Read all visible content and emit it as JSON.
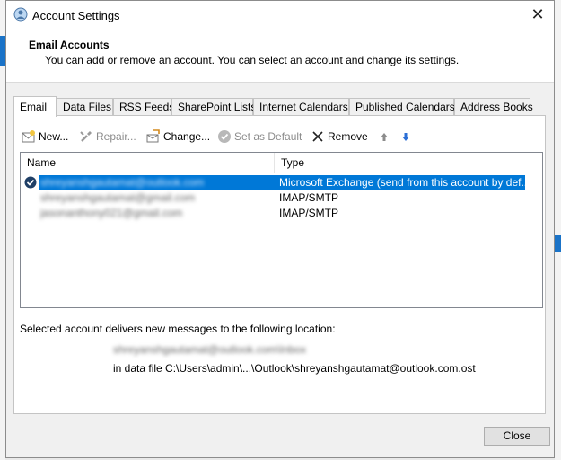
{
  "window": {
    "title": "Account Settings",
    "close_glyph": "✕"
  },
  "header": {
    "title": "Email Accounts",
    "subtitle": "You can add or remove an account. You can select an account and change its settings."
  },
  "tabs": [
    {
      "label": "Email",
      "active": true
    },
    {
      "label": "Data Files"
    },
    {
      "label": "RSS Feeds"
    },
    {
      "label": "SharePoint Lists"
    },
    {
      "label": "Internet Calendars"
    },
    {
      "label": "Published Calendars"
    },
    {
      "label": "Address Books"
    }
  ],
  "toolbar": {
    "new_label": "New...",
    "repair_label": "Repair...",
    "change_label": "Change...",
    "set_default_label": "Set as Default",
    "remove_label": "Remove"
  },
  "list": {
    "columns": {
      "name": "Name",
      "type": "Type"
    },
    "rows": [
      {
        "name": "shreyanshgautamat@outlook.com",
        "type": "Microsoft Exchange (send from this account by def..."
      },
      {
        "name": "shreyanshgautamat@gmail.com",
        "type": "IMAP/SMTP"
      },
      {
        "name": "jasonanthony021@gmail.com",
        "type": "IMAP/SMTP"
      }
    ]
  },
  "delivery": {
    "label": "Selected account delivers new messages to the following location:",
    "location": "shreyanshgautamat@outlook.com\\Inbox",
    "data_file": "in data file C:\\Users\\admin\\...\\Outlook\\shreyanshgautamat@outlook.com.ost"
  },
  "footer": {
    "close_label": "Close"
  },
  "colors": {
    "selection": "#0078d7",
    "arrow_up": "#8c8c8c",
    "arrow_down": "#2b6fd6"
  }
}
